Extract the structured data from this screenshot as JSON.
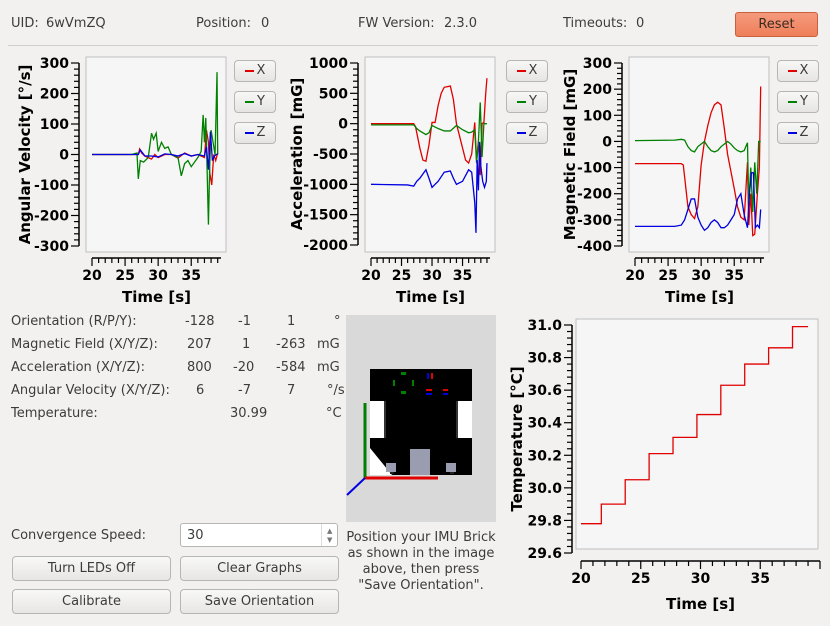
{
  "header": {
    "uid_label": "UID:",
    "uid_value": "6wVmZQ",
    "position_label": "Position:",
    "position_value": "0",
    "fw_label": "FW Version:",
    "fw_value": "2.3.0",
    "timeouts_label": "Timeouts:",
    "timeouts_value": "0",
    "reset_label": "Reset",
    "reset_color": "#f08a66"
  },
  "colors": {
    "x": "#e00000",
    "y": "#008000",
    "z": "#0000e0"
  },
  "legend": {
    "x": "X",
    "y": "Y",
    "z": "Z"
  },
  "chart_data": [
    {
      "type": "line",
      "title": "",
      "xlabel": "Time [s]",
      "ylabel": "Angular Velocity [°/s]",
      "xlim": [
        20,
        39.5
      ],
      "ylim": [
        -300,
        300
      ],
      "xticks": [
        20,
        25,
        30,
        35
      ],
      "yticks": [
        300,
        200,
        100,
        0,
        -100,
        -200,
        -300
      ],
      "legend": [
        "X",
        "Y",
        "Z"
      ],
      "legend_position": "right",
      "series": [
        {
          "name": "X",
          "x": [
            20,
            26,
            27,
            27.2,
            27.5,
            28,
            29,
            29.5,
            30,
            31,
            32,
            33,
            34,
            35,
            36,
            37,
            37.3,
            37.6,
            37.8,
            38.1,
            38.4,
            38.7,
            39
          ],
          "y": [
            0,
            0,
            0,
            18,
            5,
            -5,
            -15,
            0,
            -10,
            0,
            0,
            -12,
            5,
            -5,
            0,
            -10,
            80,
            40,
            -60,
            -100,
            0,
            -20,
            5
          ]
        },
        {
          "name": "Y",
          "x": [
            20,
            26,
            26.8,
            27,
            27.3,
            27.8,
            28.5,
            29,
            29.3,
            29.7,
            30,
            30.5,
            31,
            31.5,
            32,
            33,
            33.5,
            34,
            34.5,
            35,
            36,
            36.5,
            36.8,
            37,
            37.2,
            37.4,
            37.6,
            37.8,
            38,
            38.3,
            38.6,
            38.9,
            39
          ],
          "y": [
            0,
            0,
            5,
            -80,
            -20,
            -25,
            -10,
            70,
            50,
            70,
            10,
            40,
            20,
            25,
            0,
            -10,
            -70,
            -30,
            -20,
            -40,
            -10,
            10,
            130,
            40,
            120,
            -50,
            -230,
            -30,
            80,
            40,
            0,
            270,
            0
          ]
        },
        {
          "name": "Z",
          "x": [
            20,
            26,
            27,
            27.3,
            28,
            29,
            30,
            31,
            32,
            33,
            34,
            35,
            36,
            37,
            37.3,
            37.6,
            37.9,
            38.2,
            38.5,
            38.8,
            39
          ],
          "y": [
            0,
            0,
            0,
            15,
            -5,
            -5,
            -8,
            2,
            0,
            -5,
            3,
            -5,
            0,
            -5,
            25,
            -50,
            75,
            -20,
            -5,
            0,
            2
          ]
        }
      ]
    },
    {
      "type": "line",
      "title": "",
      "xlabel": "Time [s]",
      "ylabel": "Acceleration [mG]",
      "xlim": [
        20,
        39.5
      ],
      "ylim": [
        -2000,
        1000
      ],
      "xticks": [
        20,
        25,
        30,
        35
      ],
      "yticks": [
        1000,
        500,
        0,
        -500,
        -1000,
        -1500,
        -2000
      ],
      "legend": [
        "X",
        "Y",
        "Z"
      ],
      "legend_position": "right",
      "series": [
        {
          "name": "X",
          "x": [
            20,
            27,
            27.3,
            28,
            28.5,
            29,
            29.5,
            30,
            30.5,
            31,
            31.5,
            32,
            33,
            33.5,
            34,
            35,
            35.5,
            36,
            36.5,
            37,
            37.3,
            37.6,
            37.9,
            38.2,
            38.5,
            38.8,
            39
          ],
          "y": [
            0,
            0,
            -50,
            -400,
            -600,
            -620,
            -350,
            20,
            20,
            300,
            500,
            600,
            620,
            400,
            0,
            -400,
            -600,
            -650,
            -500,
            20,
            -600,
            -300,
            -850,
            0,
            20,
            500,
            750
          ]
        },
        {
          "name": "Y",
          "x": [
            20,
            27,
            27.5,
            28,
            29,
            29.5,
            30,
            31,
            32,
            33,
            34,
            35,
            36,
            36.5,
            37,
            37.3,
            37.6,
            37.9,
            38.2,
            38.5,
            38.8,
            39
          ],
          "y": [
            -20,
            -20,
            -80,
            -120,
            -180,
            -150,
            -30,
            -80,
            -120,
            -120,
            -30,
            -100,
            -150,
            -140,
            -100,
            -650,
            -300,
            350,
            -550,
            0,
            0,
            0
          ]
        },
        {
          "name": "Z",
          "x": [
            20,
            26,
            27,
            27.5,
            28,
            29,
            29.5,
            30,
            30.5,
            31,
            32,
            33,
            33.5,
            34,
            35,
            36,
            36.5,
            37,
            37.2,
            37.4,
            37.6,
            37.8,
            38,
            38.3,
            38.6,
            38.9,
            39
          ],
          "y": [
            -1000,
            -1010,
            -1030,
            -950,
            -900,
            -760,
            -900,
            -1050,
            -1000,
            -950,
            -800,
            -780,
            -900,
            -1000,
            -950,
            -760,
            -800,
            -1300,
            -1800,
            -600,
            -1100,
            -300,
            -700,
            -950,
            -1050,
            -950,
            -650
          ]
        }
      ]
    },
    {
      "type": "line",
      "title": "",
      "xlabel": "Time [s]",
      "ylabel": "Magnetic Field [mG]",
      "xlim": [
        20,
        39.5
      ],
      "ylim": [
        -400,
        300
      ],
      "xticks": [
        20,
        25,
        30,
        35
      ],
      "yticks": [
        300,
        200,
        100,
        0,
        -100,
        -200,
        -300,
        -400
      ],
      "legend": [
        "X",
        "Y",
        "Z"
      ],
      "legend_position": "right",
      "series": [
        {
          "name": "X",
          "x": [
            20,
            27,
            27.3,
            28,
            28.5,
            29,
            29.5,
            30,
            30.5,
            31,
            31.5,
            32,
            32.5,
            33,
            33.5,
            34,
            35,
            35.5,
            36,
            36.5,
            37,
            37.2,
            37.5,
            37.8,
            38.1,
            38.5,
            38.8,
            39
          ],
          "y": [
            -85,
            -85,
            -90,
            -250,
            -280,
            -295,
            -250,
            -90,
            0,
            60,
            110,
            140,
            150,
            140,
            50,
            -50,
            -180,
            -250,
            -290,
            -300,
            -80,
            -320,
            -200,
            -360,
            -355,
            -200,
            -100,
            210
          ]
        },
        {
          "name": "Y",
          "x": [
            20,
            26,
            27,
            27.5,
            28,
            28.5,
            29,
            29.5,
            30,
            30.5,
            31,
            31.5,
            32,
            32.5,
            33,
            34,
            34.5,
            35,
            35.5,
            36,
            36.5,
            37,
            37.2,
            37.5,
            37.8,
            38.1,
            38.4,
            38.7,
            39
          ],
          "y": [
            3,
            5,
            8,
            5,
            -20,
            -35,
            -40,
            -20,
            -10,
            0,
            -20,
            -35,
            -40,
            -35,
            -20,
            0,
            -10,
            -25,
            -35,
            -40,
            -35,
            -5,
            -240,
            -100,
            -270,
            -80,
            -200,
            0,
            0
          ]
        },
        {
          "name": "Z",
          "x": [
            20,
            26,
            27,
            27.5,
            28,
            28.5,
            29,
            29.5,
            30,
            30.5,
            31,
            31.5,
            32,
            32.5,
            33,
            33.5,
            34,
            34.5,
            35,
            35.5,
            36,
            36.5,
            37,
            37.3,
            37.6,
            37.9,
            38.2,
            38.5,
            38.8,
            39
          ],
          "y": [
            -325,
            -325,
            -320,
            -300,
            -260,
            -220,
            -220,
            -290,
            -320,
            -340,
            -330,
            -310,
            -300,
            -310,
            -330,
            -330,
            -320,
            -300,
            -280,
            -220,
            -200,
            -280,
            -330,
            -200,
            -120,
            -120,
            -330,
            -320,
            -330,
            -260
          ]
        }
      ]
    },
    {
      "type": "line",
      "title": "",
      "xlabel": "Time [s]",
      "ylabel": "Temperature [°C]",
      "xlim": [
        20,
        40
      ],
      "ylim": [
        29.6,
        31.0
      ],
      "xticks": [
        20,
        25,
        30,
        35
      ],
      "yticks": [
        31.0,
        30.8,
        30.6,
        30.4,
        30.2,
        30.0,
        29.8,
        29.6
      ],
      "ytick_labels": [
        "31.0",
        "30.8",
        "30.6",
        "30.4",
        "30.2",
        "30.0",
        "29.8",
        "29.6"
      ],
      "series": [
        {
          "name": "Temperature",
          "step": true,
          "x": [
            20,
            21.7,
            23.7,
            25.7,
            27.7,
            29.7,
            31.7,
            33.7,
            35.7,
            37.7,
            39
          ],
          "y": [
            29.78,
            29.9,
            30.05,
            30.21,
            30.31,
            30.45,
            30.63,
            30.76,
            30.86,
            30.99,
            30.99
          ]
        }
      ]
    }
  ],
  "info": {
    "rows": [
      {
        "label": "Orientation (R/P/Y):",
        "v1": "-128",
        "v2": "-1",
        "v3": "1",
        "unit": "°"
      },
      {
        "label": "Magnetic Field (X/Y/Z):",
        "v1": "207",
        "v2": "1",
        "v3": "-263",
        "unit": "mG"
      },
      {
        "label": "Acceleration (X/Y/Z):",
        "v1": "800",
        "v2": "-20",
        "v3": "-584",
        "unit": "mG"
      },
      {
        "label": "Angular Velocity (X/Y/Z):",
        "v1": "6",
        "v2": "-7",
        "v3": "7",
        "unit": "°/s"
      }
    ],
    "temperature_label": "Temperature:",
    "temperature_value": "30.99",
    "temperature_unit": "°C"
  },
  "imu_caption": "Position your IMU Brick as shown in the image above, then press \"Save Orientation\".",
  "controls": {
    "convergence_label": "Convergence Speed:",
    "convergence_value": "30",
    "turn_leds_off": "Turn LEDs Off",
    "clear_graphs": "Clear Graphs",
    "calibrate": "Calibrate",
    "save_orientation": "Save Orientation"
  }
}
